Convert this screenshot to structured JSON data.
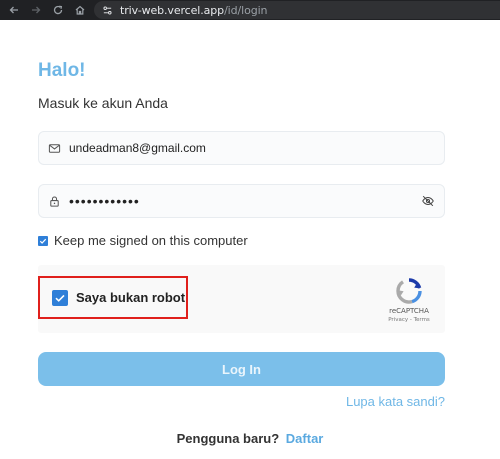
{
  "browser": {
    "url_host": "triv-web.vercel.app",
    "url_path": "/id/login",
    "icons": [
      "back-icon",
      "forward-icon",
      "reload-icon",
      "home-icon",
      "site-settings-icon"
    ]
  },
  "login": {
    "greeting": "Halo!",
    "subtitle": "Masuk ke akun Anda",
    "email_value": "undeadman8@gmail.com",
    "password_value": "••••••••••••",
    "keep_signed_in_label": "Keep me signed on this computer",
    "keep_signed_in_checked": true,
    "login_button_label": "Log In",
    "forgot_link": "Lupa kata sandi?",
    "signup_question": "Pengguna baru?",
    "signup_link": "Daftar"
  },
  "recaptcha": {
    "checkbox_label": "Saya bukan robot",
    "checked": true,
    "brand": "reCAPTCHA",
    "links": "Privacy - Terms"
  },
  "colors": {
    "accent": "#6fb7e6",
    "button": "#7bbfea",
    "checkbox": "#2f7fd8",
    "highlight_border": "#e0201c"
  }
}
